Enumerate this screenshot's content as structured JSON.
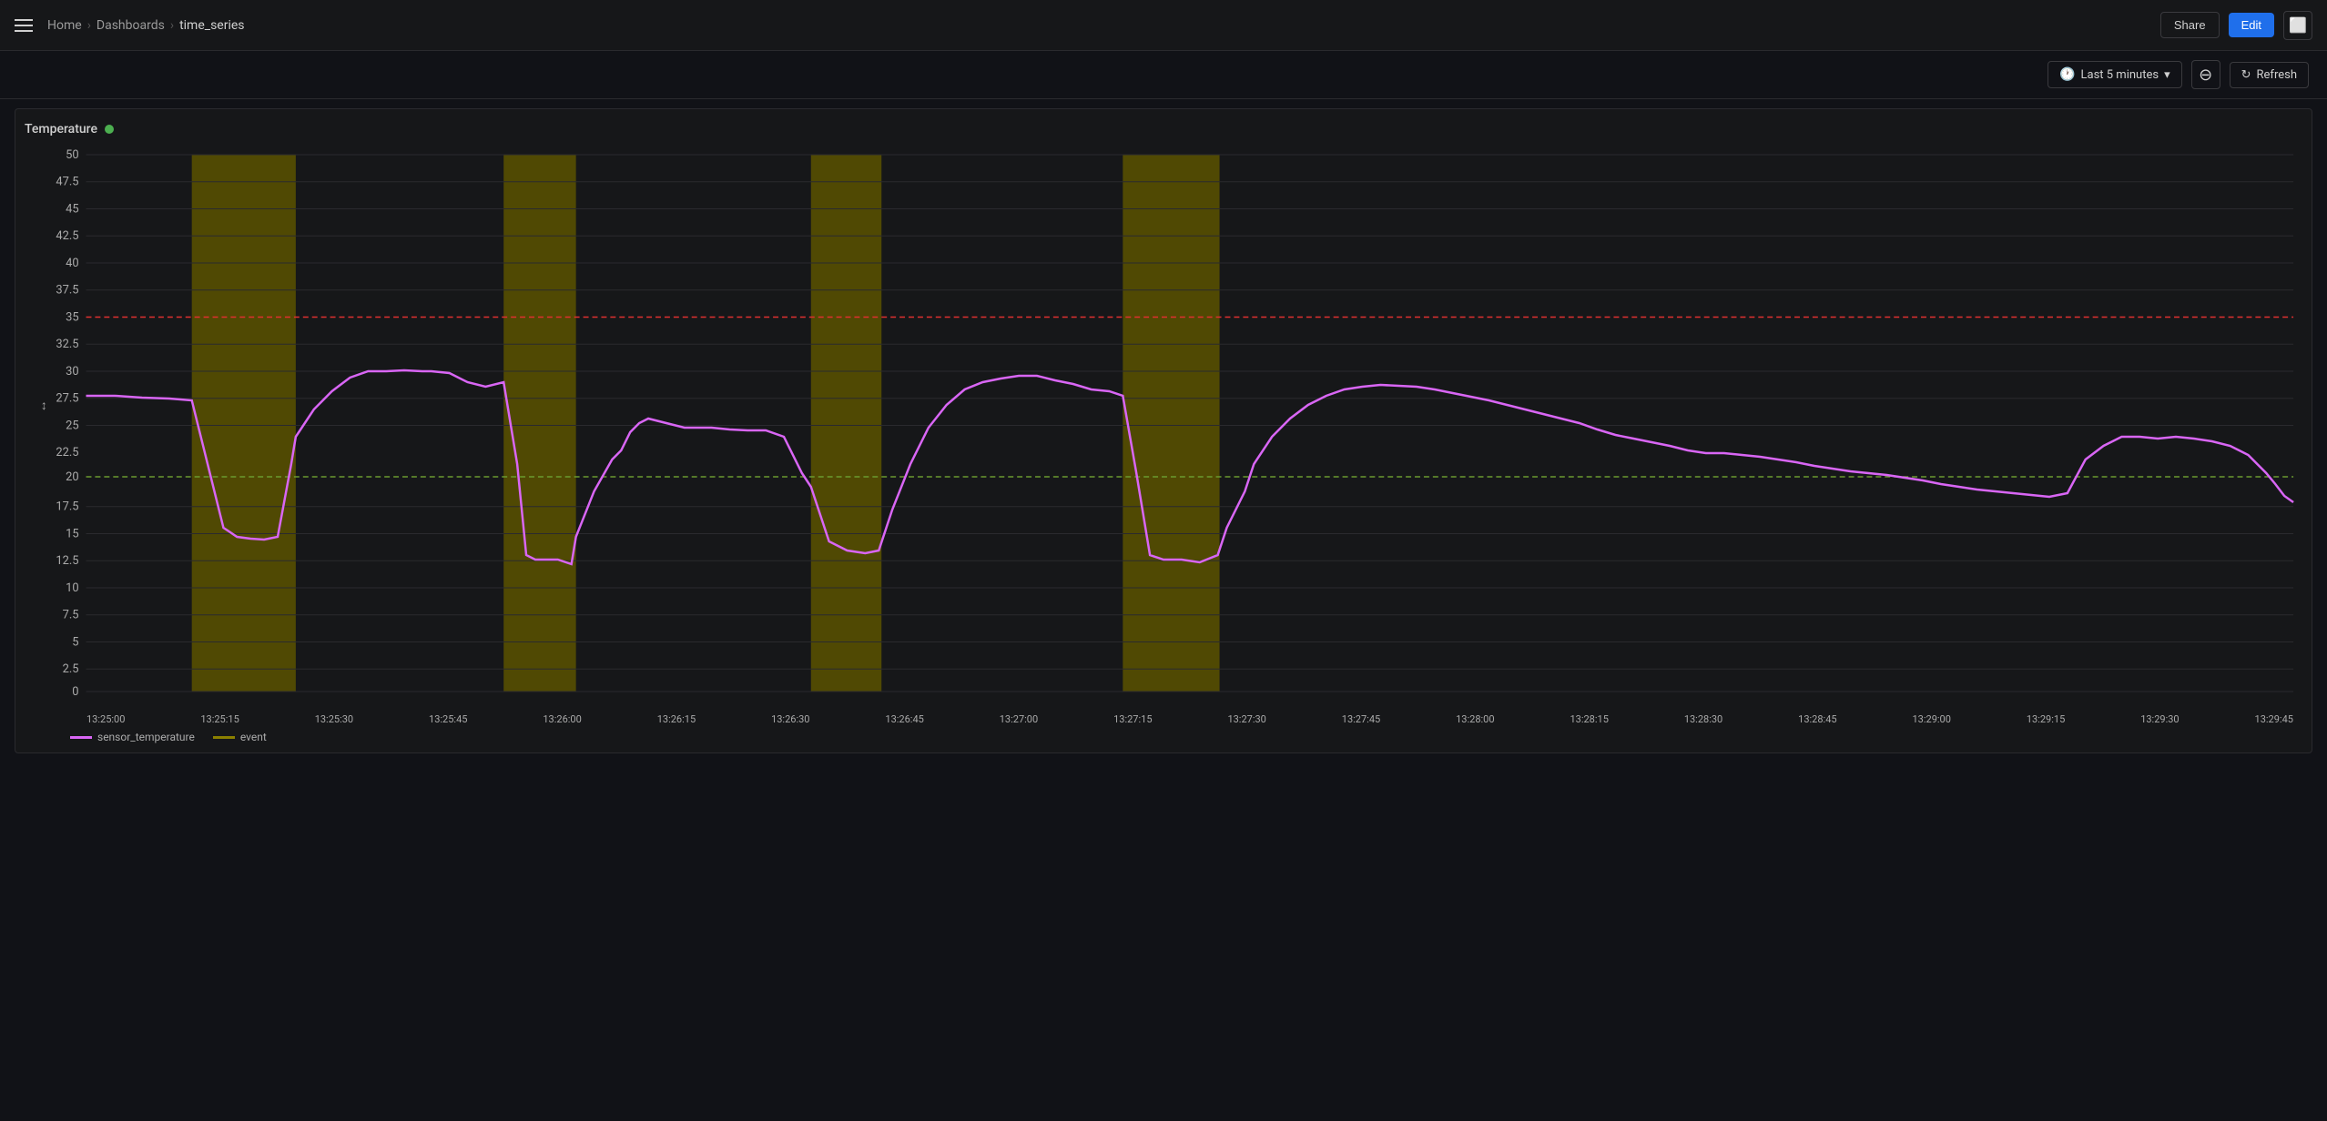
{
  "topbar": {
    "menu_icon": "☰",
    "breadcrumb": {
      "home": "Home",
      "dashboards": "Dashboards",
      "current": "time_series"
    },
    "share_label": "Share",
    "edit_label": "Edit",
    "tv_icon": "⬛"
  },
  "subtoolbar": {
    "time_range_label": "Last 5 minutes",
    "zoom_out_icon": "⊖",
    "refresh_icon": "↻",
    "refresh_label": "Refresh"
  },
  "chart": {
    "title": "Temperature",
    "status": "green",
    "y_labels": [
      "50",
      "47.5",
      "45",
      "42.5",
      "40",
      "37.5",
      "35",
      "32.5",
      "30",
      "27.5",
      "25",
      "22.5",
      "20",
      "17.5",
      "15",
      "12.5",
      "10",
      "7.5",
      "5",
      "2.5",
      "0"
    ],
    "x_labels": [
      "13:25:00",
      "13:25:15",
      "13:25:30",
      "13:25:45",
      "13:26:00",
      "13:26:15",
      "13:26:30",
      "13:26:45",
      "13:27:00",
      "13:27:15",
      "13:27:30",
      "13:27:45",
      "13:28:00",
      "13:28:15",
      "13:28:30",
      "13:28:45",
      "13:29:00",
      "13:29:15",
      "13:29:30",
      "13:29:45"
    ],
    "legend": {
      "series1_label": "sensor_temperature",
      "series2_label": "event"
    }
  }
}
